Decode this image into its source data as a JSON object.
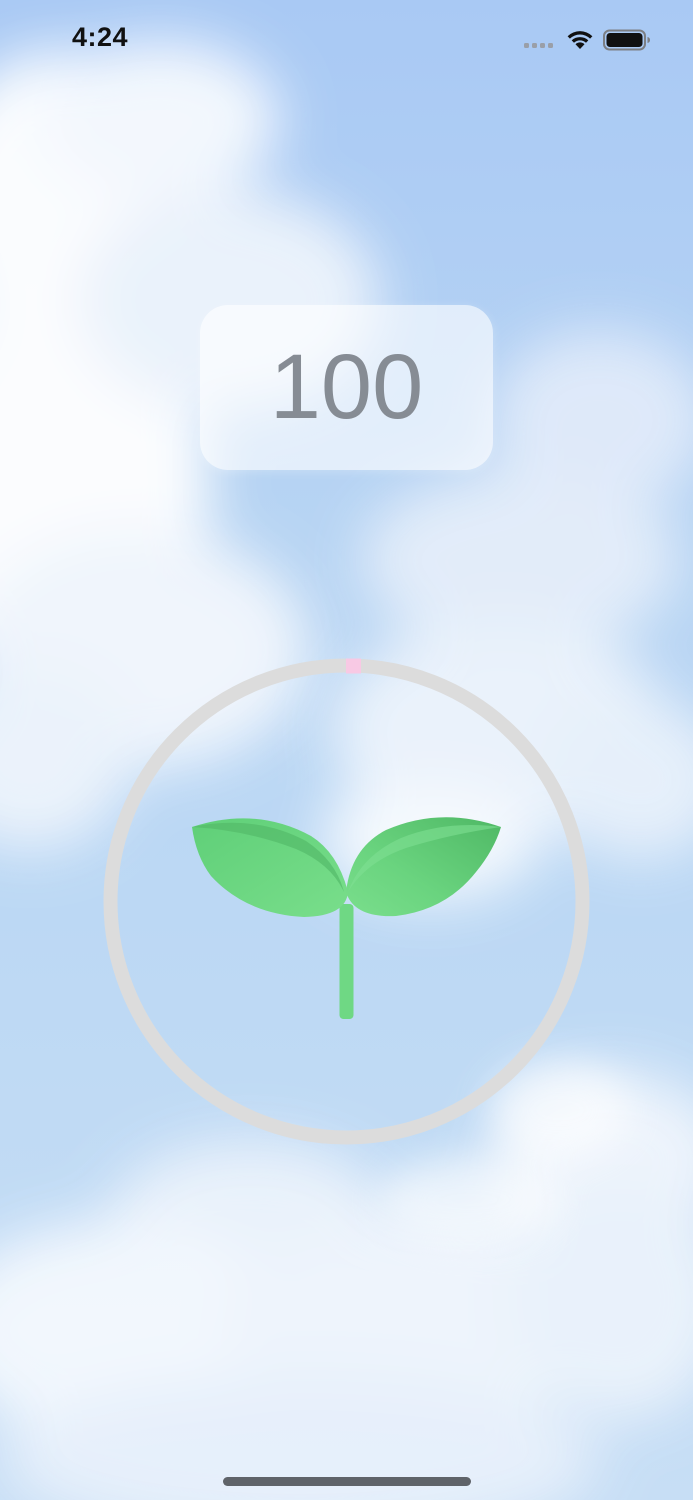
{
  "status_bar": {
    "time": "4:24",
    "signal_icon": "signal-dots-icon",
    "wifi_icon": "wifi-icon",
    "battery_icon": "battery-full-icon"
  },
  "score": {
    "value": "100"
  },
  "timer": {
    "progress": 0,
    "track_color": "#dcdcdc",
    "marker_color": "#f8c9e4"
  },
  "plant": {
    "icon": "sprout-icon",
    "leaf_color": "#6fd884",
    "stem_color": "#6fd884"
  },
  "background": {
    "theme": "sky-clouds"
  }
}
